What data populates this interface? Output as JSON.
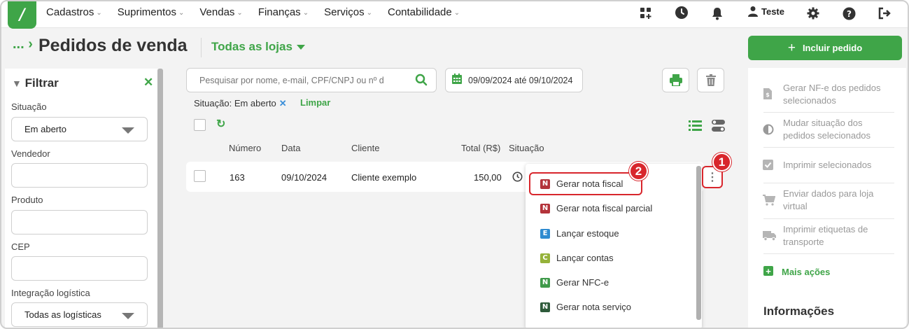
{
  "nav": {
    "logo": "/",
    "menu": [
      "Cadastros",
      "Suprimentos",
      "Vendas",
      "Finanças",
      "Serviços",
      "Contabilidade"
    ],
    "user": "Teste",
    "icons": [
      "apps-icon",
      "clock-icon",
      "bell-icon",
      "user-icon",
      "gear-icon",
      "help-icon",
      "logout-icon"
    ]
  },
  "header": {
    "breadcrumb": "...",
    "title": "Pedidos de venda",
    "store_selector": "Todas as lojas",
    "add_button": "Incluir pedido"
  },
  "filter": {
    "title": "Filtrar",
    "fields": [
      {
        "label": "Situação",
        "value": "Em aberto"
      },
      {
        "label": "Vendedor",
        "value": ""
      },
      {
        "label": "Produto",
        "value": ""
      },
      {
        "label": "CEP",
        "value": ""
      },
      {
        "label": "Integração logística",
        "value": "Todas as logísticas"
      }
    ]
  },
  "toolbar": {
    "search_placeholder": "Pesquisar por nome, e-mail, CPF/CNPJ ou nº d",
    "date_range": "09/09/2024 até 09/10/2024",
    "active_filter": "Situação: Em aberto",
    "clear_label": "Limpar"
  },
  "table": {
    "headers": [
      "Número",
      "Data",
      "Cliente",
      "Total (R$)",
      "Situação"
    ],
    "rows": [
      {
        "numero": "163",
        "data": "09/10/2024",
        "cliente": "Cliente exemplo",
        "total": "150,00"
      }
    ]
  },
  "dropdown": {
    "items": [
      {
        "badge": "N",
        "color": "#b3333a",
        "label": "Gerar nota fiscal"
      },
      {
        "badge": "N",
        "color": "#b3333a",
        "label": "Gerar nota fiscal parcial"
      },
      {
        "badge": "E",
        "color": "#2f8bd0",
        "label": "Lançar estoque"
      },
      {
        "badge": "C",
        "color": "#95b23a",
        "label": "Lançar contas"
      },
      {
        "badge": "N",
        "color": "#3f9a4a",
        "label": "Gerar NFC-e"
      },
      {
        "badge": "N",
        "color": "#2e5a3a",
        "label": "Gerar nota serviço"
      }
    ]
  },
  "steps": [
    "1",
    "2"
  ],
  "actions": {
    "items": [
      "Gerar NF-e dos pedidos selecionados",
      "Mudar situação dos pedidos selecionados",
      "Imprimir selecionados",
      "Enviar dados para loja virtual",
      "Imprimir etiquetas de transporte"
    ],
    "more": "Mais ações",
    "info_title": "Informações"
  },
  "colors": {
    "brand": "#3fa548",
    "highlight": "#d8262c",
    "link": "#3b8fd9"
  }
}
